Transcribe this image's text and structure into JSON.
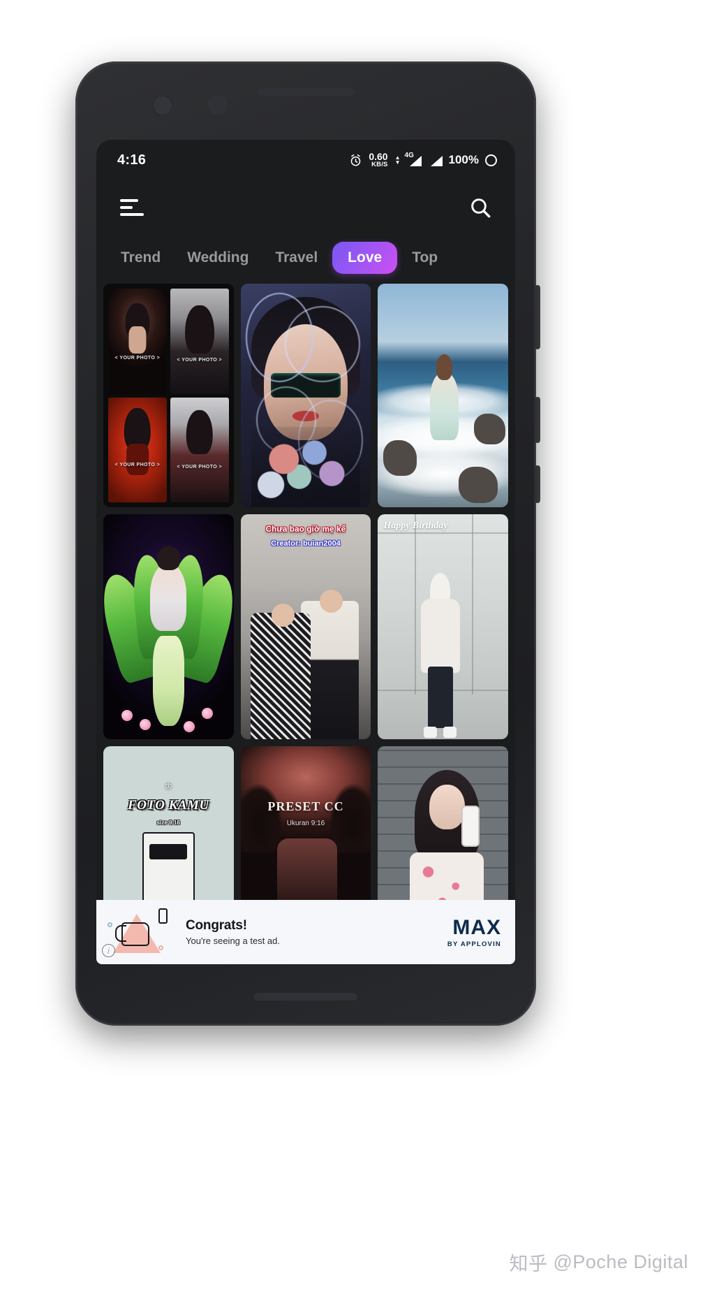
{
  "statusbar": {
    "time": "4:16",
    "alarm_icon": "alarm-clock-icon",
    "net_speed_value": "0.60",
    "net_speed_unit": "KB/S",
    "network_type": "4G",
    "signal_icon_1": "signal-bars-icon",
    "signal_icon_2": "signal-bars-icon",
    "battery_percent": "100%",
    "battery_icon": "battery-ring-icon"
  },
  "appbar": {
    "menu_icon": "hamburger-menu-icon",
    "search_icon": "search-icon"
  },
  "tabs": {
    "active": "Love",
    "items": [
      {
        "label": "Trend",
        "active": false
      },
      {
        "label": "Wedding",
        "active": false
      },
      {
        "label": "Travel",
        "active": false
      },
      {
        "label": "Love",
        "active": true
      },
      {
        "label": "Top",
        "active": false
      }
    ],
    "active_gradient_from": "#7a57f0",
    "active_gradient_to": "#cf4ef2"
  },
  "grid": {
    "cell1": {
      "name": "photo-template-collage",
      "placeholder_1": "< YOUR PHOTO >",
      "placeholder_2": "< YOUR PHOTO >",
      "placeholder_3": "< YOUR PHOTO >",
      "placeholder_4": "< YOUR PHOTO >"
    },
    "cell2": {
      "name": "neon-portrait-template"
    },
    "cell3": {
      "name": "beach-photo-template"
    },
    "cell4": {
      "name": "green-plant-fantasy-template"
    },
    "cell5": {
      "name": "vietnamese-couple-template",
      "caption_line1": "Chưa bao giờ mẹ kể",
      "caption_line2": "Creator: buian2004"
    },
    "cell6": {
      "name": "happy-birthday-shop-template",
      "caption": "Happy Birthday"
    },
    "cell7": {
      "name": "foto-kamu-template",
      "title": "FOTO KAMU",
      "subtitle": "size 9:16"
    },
    "cell8": {
      "name": "preset-cc-template",
      "title": "PRESET CC",
      "subtitle": "Ukuran 9:16"
    },
    "cell9": {
      "name": "mirror-selfie-template"
    }
  },
  "ad": {
    "title": "Congrats!",
    "subtitle": "You're seeing a test ad.",
    "brand_main": "MAX",
    "brand_sub": "BY APPLOVIN",
    "info_icon": "info-icon",
    "illustration": "thumbs-up-icon"
  },
  "watermark": {
    "logo": "知乎",
    "text": "@Poche Digital"
  }
}
